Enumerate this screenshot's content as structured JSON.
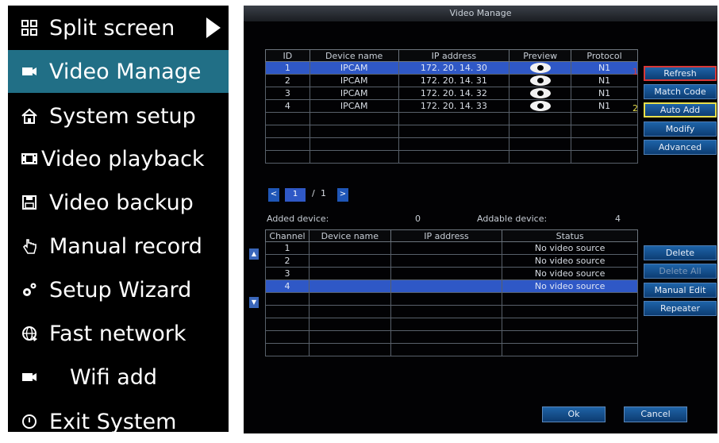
{
  "menu": {
    "items": [
      {
        "label": "Split screen",
        "icon": "split-screen-icon"
      },
      {
        "label": "Video Manage",
        "icon": "camera-icon"
      },
      {
        "label": "System setup",
        "icon": "home-icon"
      },
      {
        "label": "Video playback",
        "icon": "film-icon"
      },
      {
        "label": "Video backup",
        "icon": "floppy-disk-icon"
      },
      {
        "label": "Manual record",
        "icon": "hand-pointer-icon"
      },
      {
        "label": "Setup Wizard",
        "icon": "gears-icon"
      },
      {
        "label": "Fast network",
        "icon": "globe-icon"
      },
      {
        "label": "Wifi add",
        "icon": "camera-icon"
      },
      {
        "label": "Exit System",
        "icon": "power-icon"
      }
    ],
    "active_label": "Video Manage"
  },
  "dialog": {
    "title": "Video Manage",
    "device_table": {
      "headers": [
        "ID",
        "Device name",
        "IP address",
        "Preview",
        "Protocol"
      ],
      "rows": [
        {
          "id": "1",
          "name": "IPCAM",
          "ip": "172. 20. 14. 30",
          "protocol": "N1"
        },
        {
          "id": "2",
          "name": "IPCAM",
          "ip": "172. 20. 14. 31",
          "protocol": "N1"
        },
        {
          "id": "3",
          "name": "IPCAM",
          "ip": "172. 20. 14. 32",
          "protocol": "N1"
        },
        {
          "id": "4",
          "name": "IPCAM",
          "ip": "172. 20. 14. 33",
          "protocol": "N1"
        }
      ]
    },
    "buttons": {
      "refresh": "Refresh",
      "match_code": "Match Code",
      "auto_add": "Auto Add",
      "modify": "Modify",
      "advanced": "Advanced",
      "delete": "Delete",
      "delete_all": "Delete All",
      "manual_edit": "Manual Edit",
      "repeater": "Repeater",
      "ok": "Ok",
      "cancel": "Cancel"
    },
    "annotations": {
      "mark1": "1",
      "mark2": "2"
    },
    "pager": {
      "current": "1",
      "separator": "/",
      "total": "1",
      "prev": "<",
      "next": ">"
    },
    "added_label": "Added device:",
    "added_count": "0",
    "addable_label": "Addable device:",
    "addable_count": "4",
    "channel_table": {
      "headers": [
        "Channel",
        "Device name",
        "IP address",
        "Status"
      ],
      "rows": [
        {
          "channel": "1",
          "name": "",
          "ip": "",
          "status": "No video source"
        },
        {
          "channel": "2",
          "name": "",
          "ip": "",
          "status": "No video source"
        },
        {
          "channel": "3",
          "name": "",
          "ip": "",
          "status": "No video source"
        },
        {
          "channel": "4",
          "name": "",
          "ip": "",
          "status": "No video source"
        }
      ]
    },
    "scroll": {
      "up": "▲",
      "down": "▼"
    }
  },
  "colors": {
    "menu_active": "#216f86",
    "selection": "#2f58c6",
    "button": "#1e63a8",
    "refresh_border": "#d83838",
    "auto_add_border": "#e8df4c"
  }
}
